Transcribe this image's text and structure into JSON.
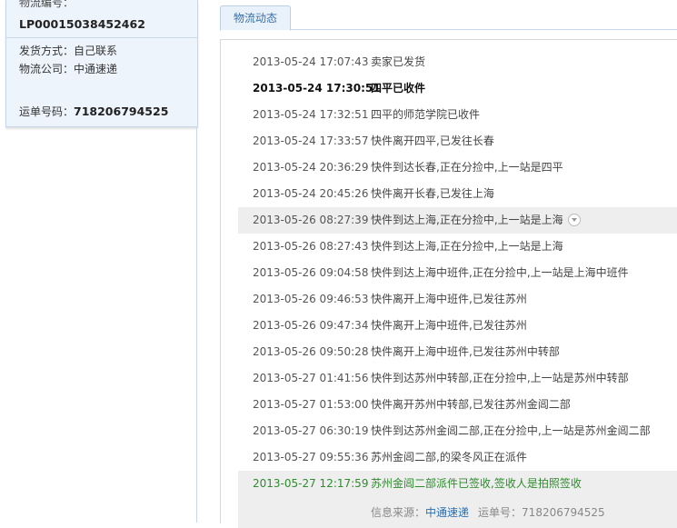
{
  "shipment": {
    "number_label": "物流编号：",
    "number_value": "LP00015038452462",
    "method_label": "发货方式：",
    "method_value": "自己联系",
    "company_label": "物流公司：",
    "company_value": "中通速递",
    "waybill_label": "运单号码：",
    "waybill_value": "718206794525"
  },
  "tabs": [
    {
      "label": "物流动态"
    }
  ],
  "events": [
    {
      "time": "2013-05-24 17:07:43",
      "desc": "卖家已发货"
    },
    {
      "time": "2013-05-24 17:30:51",
      "desc": "四平已收件"
    },
    {
      "time": "2013-05-24 17:32:51",
      "desc": "四平的师范学院已收件"
    },
    {
      "time": "2013-05-24 17:33:57",
      "desc": "快件离开四平,已发往长春"
    },
    {
      "time": "2013-05-24 20:36:29",
      "desc": "快件到达长春,正在分捡中,上一站是四平"
    },
    {
      "time": "2013-05-24 20:45:26",
      "desc": "快件离开长春,已发往上海"
    },
    {
      "time": "2013-05-26 08:27:39",
      "desc": "快件到达上海,正在分捡中,上一站是上海"
    },
    {
      "time": "2013-05-26 08:27:43",
      "desc": "快件到达上海,正在分捡中,上一站是上海"
    },
    {
      "time": "2013-05-26 09:04:58",
      "desc": "快件到达上海中班件,正在分捡中,上一站是上海中班件"
    },
    {
      "time": "2013-05-26 09:46:53",
      "desc": "快件离开上海中班件,已发往苏州"
    },
    {
      "time": "2013-05-26 09:47:34",
      "desc": "快件离开上海中班件,已发往苏州"
    },
    {
      "time": "2013-05-26 09:50:28",
      "desc": "快件离开上海中班件,已发往苏州中转部"
    },
    {
      "time": "2013-05-27 01:41:56",
      "desc": "快件到达苏州中转部,正在分捡中,上一站是苏州中转部"
    },
    {
      "time": "2013-05-27 01:53:00",
      "desc": "快件离开苏州中转部,已发往苏州金阊二部"
    },
    {
      "time": "2013-05-27 06:30:19",
      "desc": "快件到达苏州金阊二部,正在分捡中,上一站是苏州金阊二部"
    },
    {
      "time": "2013-05-27 09:55:36",
      "desc": "苏州金阊二部,的梁冬风正在派件"
    },
    {
      "time": "2013-05-27 12:17:59",
      "desc": "苏州金阊二部派件已签收,签收人是拍照签收"
    }
  ],
  "source": {
    "label": "信息来源：",
    "company": "中通速递",
    "waybill_label": "运单号：",
    "waybill_value": "718206794525"
  },
  "colors": {
    "accent": "#3a6ea5",
    "final_status": "#2e8b2e",
    "panel_bg": "#eef4fb"
  }
}
